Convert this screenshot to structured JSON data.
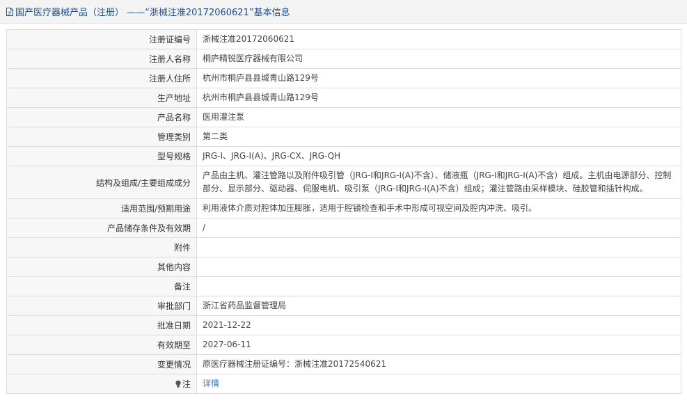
{
  "header": {
    "title": "国产医疗器械产品（注册） ——“浙械注准20172060621”基本信息"
  },
  "rows": [
    {
      "label": "注册证编号",
      "value": "浙械注准20172060621"
    },
    {
      "label": "注册人名称",
      "value": "桐庐精锐医疗器械有限公司"
    },
    {
      "label": "注册人住所",
      "value": "杭州市桐庐县县城青山路129号"
    },
    {
      "label": "生产地址",
      "value": "杭州市桐庐县县城青山路129号"
    },
    {
      "label": "产品名称",
      "value": "医用灌注泵"
    },
    {
      "label": "管理类别",
      "value": "第二类"
    },
    {
      "label": "型号规格",
      "value": "JRG-I、JRG-I(A)、JRG-CX、JRG-QH"
    },
    {
      "label": "结构及组成/主要组成成分",
      "value": "产品由主机、灌注管路以及附件吸引管（JRG-I和JRG-I(A)不含）、储液瓶（JRG-I和JRG-I(A)不含）组成。主机由电源部分、控制部分、显示部分、驱动器、伺服电机、吸引泵（JRG-I和JRG-I(A)不含）组成；灌注管路由采样模块、硅胶管和插针构成。"
    },
    {
      "label": "适用范围/预期用途",
      "value": "利用液体介质对腔体加压膨胀，适用于腔镜检查和手术中形成可视空间及腔内冲洗、吸引。"
    },
    {
      "label": "产品储存条件及有效期",
      "value": "/"
    },
    {
      "label": "附件",
      "value": ""
    },
    {
      "label": "其他内容",
      "value": ""
    },
    {
      "label": "备注",
      "value": ""
    },
    {
      "label": "审批部门",
      "value": "浙江省药品监督管理局"
    },
    {
      "label": "批准日期",
      "value": "2021-12-22"
    },
    {
      "label": "有效期至",
      "value": "2027-06-11"
    },
    {
      "label": "变更情况",
      "value": "原医疗器械注册证编号：浙械注准20172540621"
    },
    {
      "label": "注",
      "value": "详情"
    }
  ],
  "icons": {
    "header_icon": "document-icon",
    "note_icon": "lightbulb-icon"
  },
  "colors": {
    "title": "#1f4f8f",
    "link": "#3173c7",
    "label_bg": "#f7f7f7",
    "border": "#dcdcdc"
  }
}
